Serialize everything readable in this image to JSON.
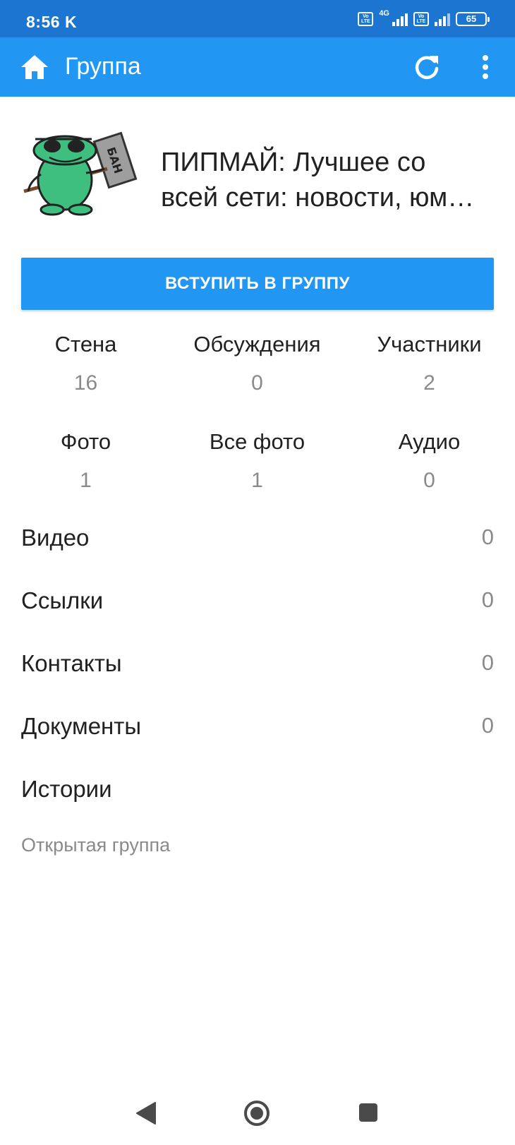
{
  "status_bar": {
    "time": "8:56",
    "carrier_icon": "K",
    "volte_label": "Vo LTE",
    "network_type": "4G",
    "battery": "65"
  },
  "app_bar": {
    "title": "Группа",
    "icons": [
      "home-icon",
      "refresh-icon",
      "more-vert-icon"
    ]
  },
  "group": {
    "name": "ПИПМАЙ: Лучшее со\nвсей сети: новости, юм…",
    "avatar_sign_text": "БАН"
  },
  "join_button_label": "ВСТУПИТЬ В ГРУППУ",
  "stats": [
    {
      "label": "Стена",
      "value": "16"
    },
    {
      "label": "Обсуждения",
      "value": "0"
    },
    {
      "label": "Участники",
      "value": "2"
    },
    {
      "label": "Фото",
      "value": "1"
    },
    {
      "label": "Все фото",
      "value": "1"
    },
    {
      "label": "Аудио",
      "value": "0"
    }
  ],
  "rows": [
    {
      "label": "Видео",
      "count": "0"
    },
    {
      "label": "Ссылки",
      "count": "0"
    },
    {
      "label": "Контакты",
      "count": "0"
    },
    {
      "label": "Документы",
      "count": "0"
    },
    {
      "label": "Истории",
      "count": ""
    }
  ],
  "group_type": "Открытая группа",
  "colors": {
    "status_bar": "#1d75d2",
    "app_bar": "#2196f3",
    "accent": "#2196f3",
    "secondary_text": "#8a8a8a",
    "avatar_green": "#3fbf7f"
  }
}
